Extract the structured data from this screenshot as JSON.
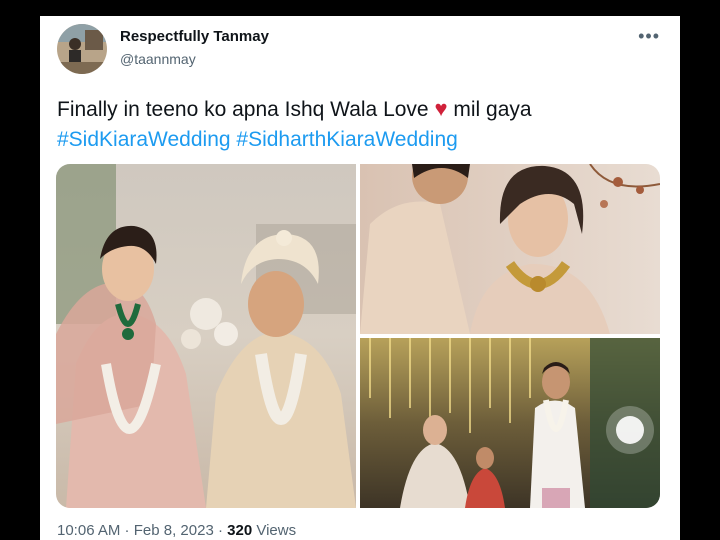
{
  "author": {
    "display_name": "Respectfully Tanmay",
    "handle": "@taannmay"
  },
  "tweet": {
    "text_before": "Finally in teeno ko apna Ishq Wala Love ",
    "heart": "♥",
    "text_after": " mil gaya",
    "hashtags": [
      "#SidKiaraWedding",
      "#SidharthKiaraWedding"
    ]
  },
  "meta": {
    "time": "10:06 AM",
    "separator": " · ",
    "date": "Feb 8, 2023",
    "views_count": "320",
    "views_label": "Views"
  },
  "icons": {
    "more": "more-horizontal-icon",
    "heart": "heart-emoji-icon"
  },
  "colors": {
    "background": "#000000",
    "card": "#ffffff",
    "link": "#1d9bf0",
    "text": "#0f1419",
    "secondary": "#536471",
    "heart": "#d0213a"
  }
}
